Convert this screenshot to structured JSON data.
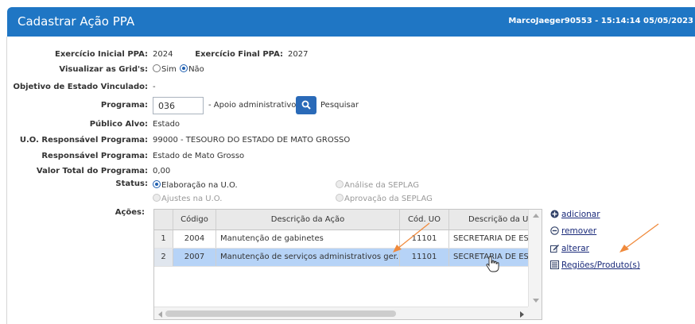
{
  "header": {
    "title": "Cadastrar Ação PPA",
    "user_info": "MarcoJaeger90553 - 15:14:14 05/05/2023"
  },
  "form": {
    "exercicio_inicial_label": "Exercício Inicial PPA:",
    "exercicio_inicial_value": "2024",
    "exercicio_final_label": "Exercício Final PPA:",
    "exercicio_final_value": "2027",
    "visualizar_label": "Visualizar as Grid's:",
    "visualizar_sim": "Sim",
    "visualizar_nao": "Não",
    "objetivo_label": "Objetivo de Estado Vinculado:",
    "objetivo_value": "-",
    "programa_label": "Programa:",
    "programa_value": "036",
    "programa_desc": "- Apoio administrativo",
    "pesquisar_label": "Pesquisar",
    "publico_label": "Público Alvo:",
    "publico_value": "Estado",
    "uo_label": "U.O. Responsável Programa:",
    "uo_value": "99000 - TESOURO DO ESTADO DE MATO GROSSO",
    "resp_label": "Responsável Programa:",
    "resp_value": "Estado de Mato Grosso",
    "valor_label": "Valor Total do Programa:",
    "valor_value": "0,00",
    "status_label": "Status:",
    "status_options": [
      "Elaboração na U.O.",
      "Análise da SEPLAG",
      "Ajustes na U.O.",
      "Aprovação da SEPLAG"
    ],
    "acoes_label": "Ações:"
  },
  "grid": {
    "columns": [
      "Código",
      "Descrição da Ação",
      "Cód. UO",
      "Descrição da Un"
    ],
    "rows": [
      {
        "n": "1",
        "codigo": "2004",
        "descricao": "Manutenção de gabinetes",
        "cod_uo": "11101",
        "desc_un": "SECRETARIA DE ES"
      },
      {
        "n": "2",
        "codigo": "2007",
        "descricao": "Manutenção de serviços administrativos ger...",
        "cod_uo": "11101",
        "desc_un": "SECRETARIA DE ES"
      }
    ]
  },
  "actions": {
    "adicionar": "adicionar",
    "remover": "remover",
    "alterar": "alterar",
    "regioes": "Regiões/Produto(s)"
  },
  "colors": {
    "header_bg": "#1f76c4",
    "selected_row": "#b6d3f7",
    "annotation_arrow": "#f08a3c"
  }
}
